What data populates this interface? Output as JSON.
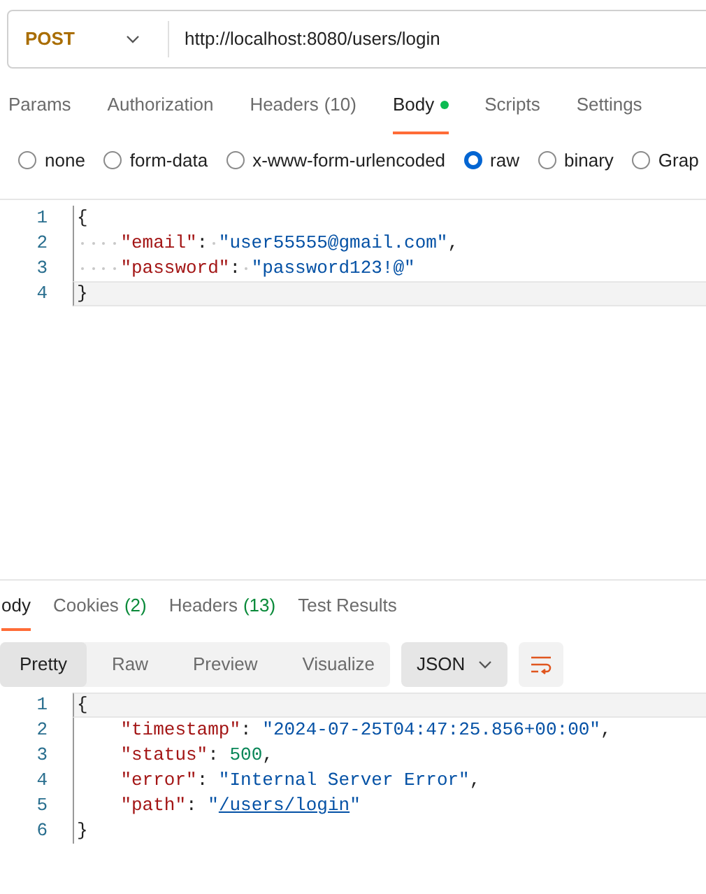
{
  "request": {
    "method": "POST",
    "url": "http://localhost:8080/users/login"
  },
  "request_tabs": [
    {
      "label": "Params",
      "selected": false,
      "dot": false
    },
    {
      "label": "Authorization",
      "selected": false,
      "dot": false
    },
    {
      "label": "Headers",
      "count": "(10)",
      "selected": false,
      "dot": false
    },
    {
      "label": "Body",
      "selected": true,
      "dot": true
    },
    {
      "label": "Scripts",
      "selected": false,
      "dot": false
    },
    {
      "label": "Settings",
      "selected": false,
      "dot": false
    }
  ],
  "body_types": [
    {
      "label": "none",
      "selected": false
    },
    {
      "label": "form-data",
      "selected": false
    },
    {
      "label": "x-www-form-urlencoded",
      "selected": false
    },
    {
      "label": "raw",
      "selected": true
    },
    {
      "label": "binary",
      "selected": false
    },
    {
      "label": "Grap",
      "selected": false
    }
  ],
  "request_body": [
    {
      "number": "1",
      "active": false,
      "tokens": [
        {
          "kind": "punct",
          "text": "{"
        }
      ]
    },
    {
      "number": "2",
      "active": false,
      "tokens": [
        {
          "kind": "dotted_indent"
        },
        {
          "kind": "key",
          "text": "\"email\""
        },
        {
          "kind": "punct",
          "text": ":"
        },
        {
          "kind": "dotted_space"
        },
        {
          "kind": "string",
          "text": "\"user55555@gmail.com\""
        },
        {
          "kind": "punct",
          "text": ","
        }
      ]
    },
    {
      "number": "3",
      "active": false,
      "tokens": [
        {
          "kind": "dotted_indent"
        },
        {
          "kind": "key",
          "text": "\"password\""
        },
        {
          "kind": "punct",
          "text": ":"
        },
        {
          "kind": "dotted_space"
        },
        {
          "kind": "string",
          "text": "\"password123!@\""
        }
      ]
    },
    {
      "number": "4",
      "active": true,
      "tokens": [
        {
          "kind": "punct",
          "text": "}"
        }
      ]
    }
  ],
  "response_tabs": [
    {
      "label": "ody",
      "selected": true
    },
    {
      "label": "Cookies",
      "count": "(2)",
      "selected": false
    },
    {
      "label": "Headers",
      "count": "(13)",
      "selected": false
    },
    {
      "label": "Test Results",
      "selected": false
    }
  ],
  "view_modes": [
    {
      "label": "Pretty",
      "selected": true
    },
    {
      "label": "Raw",
      "selected": false
    },
    {
      "label": "Preview",
      "selected": false
    },
    {
      "label": "Visualize",
      "selected": false
    }
  ],
  "format": "JSON",
  "response_body": [
    {
      "number": "1",
      "active": true,
      "tokens": [
        {
          "kind": "punct",
          "text": "{"
        }
      ]
    },
    {
      "number": "2",
      "active": false,
      "tokens": [
        {
          "kind": "indent"
        },
        {
          "kind": "key",
          "text": "\"timestamp\""
        },
        {
          "kind": "punct",
          "text": ": "
        },
        {
          "kind": "string",
          "text": "\"2024-07-25T04:47:25.856+00:00\""
        },
        {
          "kind": "punct",
          "text": ","
        }
      ]
    },
    {
      "number": "3",
      "active": false,
      "tokens": [
        {
          "kind": "indent"
        },
        {
          "kind": "key",
          "text": "\"status\""
        },
        {
          "kind": "punct",
          "text": ": "
        },
        {
          "kind": "number",
          "text": "500"
        },
        {
          "kind": "punct",
          "text": ","
        }
      ]
    },
    {
      "number": "4",
      "active": false,
      "tokens": [
        {
          "kind": "indent"
        },
        {
          "kind": "key",
          "text": "\"error\""
        },
        {
          "kind": "punct",
          "text": ": "
        },
        {
          "kind": "string",
          "text": "\"Internal Server Error\""
        },
        {
          "kind": "punct",
          "text": ","
        }
      ]
    },
    {
      "number": "5",
      "active": false,
      "tokens": [
        {
          "kind": "indent"
        },
        {
          "kind": "key",
          "text": "\"path\""
        },
        {
          "kind": "punct",
          "text": ": "
        },
        {
          "kind": "string",
          "text": "\""
        },
        {
          "kind": "link",
          "text": "/users/login"
        },
        {
          "kind": "string",
          "text": "\""
        }
      ]
    },
    {
      "number": "6",
      "active": false,
      "tokens": [
        {
          "kind": "punct",
          "text": "}"
        }
      ]
    }
  ]
}
